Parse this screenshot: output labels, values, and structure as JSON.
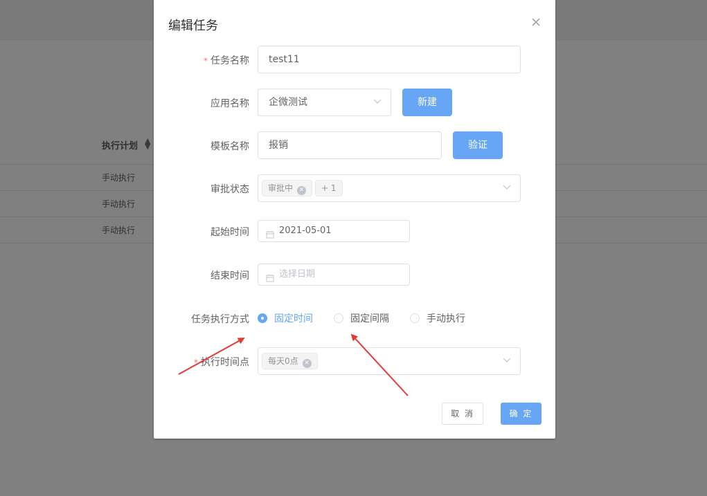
{
  "background": {
    "table_header": "执行计划",
    "rows": [
      "手动执行",
      "手动执行",
      "手动执行"
    ]
  },
  "dialog": {
    "title": "编辑任务",
    "fields": {
      "task_name": {
        "label": "任务名称",
        "value": "test11",
        "required": "*"
      },
      "app_name": {
        "label": "应用名称",
        "value": "企微测试",
        "button": "新建"
      },
      "template_name": {
        "label": "模板名称",
        "value": "报销",
        "button": "验证"
      },
      "approval_status": {
        "label": "审批状态",
        "tags": [
          "审批中",
          "+ 1"
        ]
      },
      "start_time": {
        "label": "起始时间",
        "value": "2021-05-01"
      },
      "end_time": {
        "label": "结束时间",
        "placeholder": "选择日期"
      },
      "exec_mode": {
        "label": "任务执行方式",
        "options": [
          "固定时间",
          "固定间隔",
          "手动执行"
        ],
        "selected": "固定时间"
      },
      "exec_point": {
        "label": "执行时间点",
        "required": "*",
        "tags": [
          "每天0点"
        ]
      }
    },
    "footer": {
      "cancel": "取 消",
      "ok": "确 定"
    }
  },
  "colors": {
    "primary": "#66a6f4",
    "arrow": "#e53935",
    "required": "#f56c6c"
  }
}
